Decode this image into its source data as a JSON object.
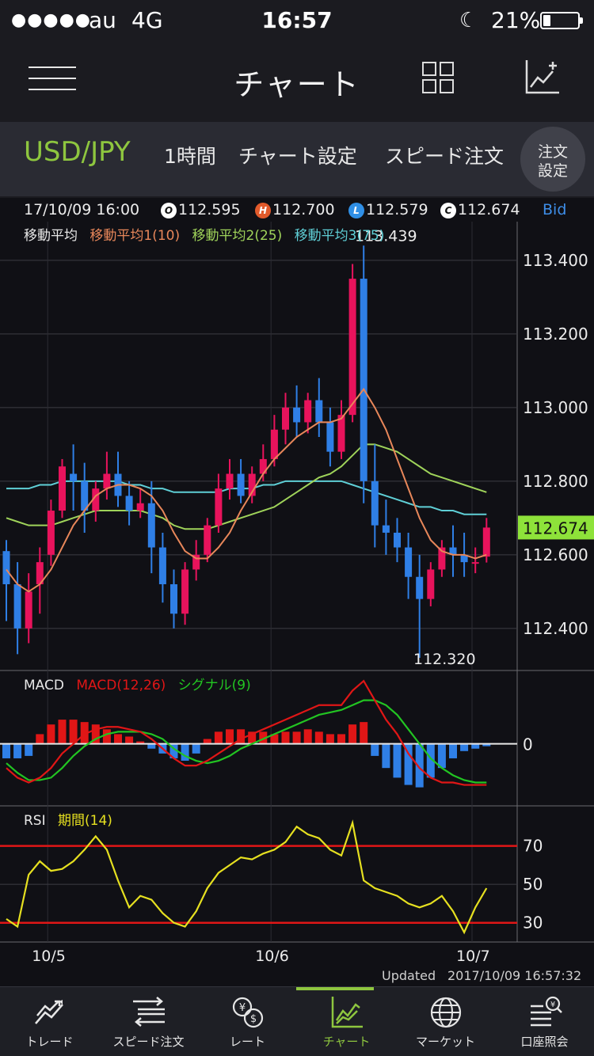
{
  "status_bar": {
    "signal_dots": "●●●●●",
    "carrier": "au",
    "network": "4G",
    "time": "16:57",
    "battery_percent": "21%",
    "icons": [
      "signal-dots-icon",
      "moon-icon",
      "battery-icon"
    ]
  },
  "nav": {
    "title": "チャート",
    "icons": [
      "menu-icon",
      "layout-grid-icon",
      "chart-add-icon"
    ]
  },
  "toolbar": {
    "pair": "USD/JPY",
    "timeframe": "1時間",
    "chart_settings": "チャート設定",
    "speed_order": "スピード注文",
    "order_settings_line1": "注文",
    "order_settings_line2": "設定"
  },
  "ohlc": {
    "datetime": "17/10/09 16:00",
    "open_badge": "O",
    "open": "112.595",
    "high_badge": "H",
    "high": "112.700",
    "low_badge": "L",
    "low": "112.579",
    "close_badge": "C",
    "close": "112.674",
    "price_type": "Bid"
  },
  "ma_legend": {
    "label": "移動平均",
    "ma1": "移動平均1(10)",
    "ma2": "移動平均2(25)",
    "ma3": "移動平均3(75)"
  },
  "macd_legend": {
    "label": "MACD",
    "macd": "MACD(12,26)",
    "signal": "シグナル(9)"
  },
  "rsi_legend": {
    "label": "RSI",
    "period": "期間(14)"
  },
  "updated": {
    "label": "Updated",
    "datetime": "2017/10/09 16:57:32"
  },
  "tabs": [
    {
      "label": "トレード",
      "icon": "trade-icon",
      "active": false
    },
    {
      "label": "スピード注文",
      "icon": "speed-order-icon",
      "active": false
    },
    {
      "label": "レート",
      "icon": "rate-icon",
      "active": false
    },
    {
      "label": "チャート",
      "icon": "chart-icon",
      "active": true
    },
    {
      "label": "マーケット",
      "icon": "globe-icon",
      "active": false
    },
    {
      "label": "口座照会",
      "icon": "account-search-icon",
      "active": false
    }
  ],
  "colors": {
    "accent": "#8ec63f",
    "candle_up": "#e8135c",
    "candle_down": "#2f7fe6",
    "ma1": "#e8875a",
    "ma2": "#9fd35a",
    "ma3": "#5fcfd6",
    "macd": "#e01616",
    "signal": "#22c422",
    "rsi": "#e6e020",
    "rsi_bands": "#e01616",
    "current_price_bg": "#8ee23a"
  },
  "chart_data": [
    {
      "type": "candlestick",
      "title": "USD/JPY 1時間",
      "price_axis_labels": [
        "113.400",
        "113.200",
        "113.000",
        "112.800",
        "112.600",
        "112.400"
      ],
      "price_axis_values": [
        113.4,
        113.2,
        113.0,
        112.8,
        112.6,
        112.4
      ],
      "ylim": [
        112.29,
        113.505
      ],
      "x_labels": [
        "10/5",
        "10/6",
        "10/7"
      ],
      "x_label_index": [
        2,
        22,
        40
      ],
      "high_annotation": "113.439",
      "high_value": 113.439,
      "low_annotation": "112.320",
      "low_value": 112.32,
      "current_price_label": "112.674",
      "current_price": 112.674,
      "grid": true,
      "legend_position": "top-left",
      "candles": [
        {
          "o": 112.61,
          "h": 112.64,
          "c": 112.52,
          "l": 112.42
        },
        {
          "o": 112.52,
          "h": 112.58,
          "c": 112.4,
          "l": 112.33
        },
        {
          "o": 112.4,
          "h": 112.55,
          "c": 112.5,
          "l": 112.36
        },
        {
          "o": 112.52,
          "h": 112.62,
          "c": 112.58,
          "l": 112.44
        },
        {
          "o": 112.6,
          "h": 112.75,
          "c": 112.72,
          "l": 112.57
        },
        {
          "o": 112.72,
          "h": 112.86,
          "c": 112.84,
          "l": 112.7
        },
        {
          "o": 112.82,
          "h": 112.9,
          "c": 112.8,
          "l": 112.72
        },
        {
          "o": 112.8,
          "h": 112.85,
          "c": 112.72,
          "l": 112.66
        },
        {
          "o": 112.72,
          "h": 112.8,
          "c": 112.78,
          "l": 112.69
        },
        {
          "o": 112.78,
          "h": 112.88,
          "c": 112.82,
          "l": 112.75
        },
        {
          "o": 112.82,
          "h": 112.88,
          "c": 112.76,
          "l": 112.73
        },
        {
          "o": 112.76,
          "h": 112.8,
          "c": 112.72,
          "l": 112.68
        },
        {
          "o": 112.72,
          "h": 112.78,
          "c": 112.74,
          "l": 112.7
        },
        {
          "o": 112.74,
          "h": 112.8,
          "c": 112.62,
          "l": 112.55
        },
        {
          "o": 112.62,
          "h": 112.66,
          "c": 112.52,
          "l": 112.47
        },
        {
          "o": 112.52,
          "h": 112.56,
          "c": 112.44,
          "l": 112.4
        },
        {
          "o": 112.44,
          "h": 112.58,
          "c": 112.56,
          "l": 112.41
        },
        {
          "o": 112.56,
          "h": 112.64,
          "c": 112.6,
          "l": 112.53
        },
        {
          "o": 112.6,
          "h": 112.7,
          "c": 112.68,
          "l": 112.58
        },
        {
          "o": 112.68,
          "h": 112.82,
          "c": 112.78,
          "l": 112.66
        },
        {
          "o": 112.78,
          "h": 112.86,
          "c": 112.82,
          "l": 112.75
        },
        {
          "o": 112.82,
          "h": 112.86,
          "c": 112.76,
          "l": 112.74
        },
        {
          "o": 112.76,
          "h": 112.84,
          "c": 112.82,
          "l": 112.74
        },
        {
          "o": 112.82,
          "h": 112.9,
          "c": 112.86,
          "l": 112.8
        },
        {
          "o": 112.86,
          "h": 112.98,
          "c": 112.94,
          "l": 112.84
        },
        {
          "o": 112.94,
          "h": 113.04,
          "c": 113.0,
          "l": 112.9
        },
        {
          "o": 113.0,
          "h": 113.06,
          "c": 112.96,
          "l": 112.92
        },
        {
          "o": 112.96,
          "h": 113.04,
          "c": 113.02,
          "l": 112.93
        },
        {
          "o": 113.02,
          "h": 113.08,
          "c": 112.96,
          "l": 112.92
        },
        {
          "o": 112.96,
          "h": 113.0,
          "c": 112.88,
          "l": 112.84
        },
        {
          "o": 112.88,
          "h": 113.02,
          "c": 112.98,
          "l": 112.86
        },
        {
          "o": 112.98,
          "h": 113.39,
          "c": 113.35,
          "l": 112.96
        },
        {
          "o": 113.35,
          "h": 113.44,
          "c": 112.8,
          "l": 112.74
        },
        {
          "o": 112.8,
          "h": 112.9,
          "c": 112.68,
          "l": 112.62
        },
        {
          "o": 112.68,
          "h": 112.75,
          "c": 112.66,
          "l": 112.6
        },
        {
          "o": 112.66,
          "h": 112.7,
          "c": 112.62,
          "l": 112.58
        },
        {
          "o": 112.62,
          "h": 112.66,
          "c": 112.54,
          "l": 112.48
        },
        {
          "o": 112.54,
          "h": 112.6,
          "c": 112.48,
          "l": 112.32
        },
        {
          "o": 112.48,
          "h": 112.58,
          "c": 112.56,
          "l": 112.46
        },
        {
          "o": 112.56,
          "h": 112.64,
          "c": 112.62,
          "l": 112.54
        },
        {
          "o": 112.62,
          "h": 112.68,
          "c": 112.6,
          "l": 112.54
        },
        {
          "o": 112.6,
          "h": 112.66,
          "c": 112.58,
          "l": 112.54
        },
        {
          "o": 112.58,
          "h": 112.62,
          "c": 112.58,
          "l": 112.55
        },
        {
          "o": 112.595,
          "h": 112.7,
          "c": 112.674,
          "l": 112.579
        }
      ],
      "ma1_10": [
        112.56,
        112.52,
        112.5,
        112.52,
        112.56,
        112.62,
        112.68,
        112.72,
        112.76,
        112.78,
        112.79,
        112.79,
        112.78,
        112.76,
        112.72,
        112.66,
        112.61,
        112.59,
        112.59,
        112.62,
        112.66,
        112.72,
        112.77,
        112.82,
        112.86,
        112.89,
        112.92,
        112.94,
        112.96,
        112.96,
        112.97,
        113.01,
        113.05,
        113.0,
        112.94,
        112.86,
        112.78,
        112.7,
        112.64,
        112.61,
        112.6,
        112.6,
        112.59,
        112.6
      ],
      "ma2_25": [
        112.7,
        112.69,
        112.68,
        112.68,
        112.68,
        112.69,
        112.7,
        112.71,
        112.72,
        112.72,
        112.72,
        112.72,
        112.72,
        112.71,
        112.7,
        112.68,
        112.67,
        112.67,
        112.67,
        112.68,
        112.69,
        112.7,
        112.71,
        112.72,
        112.73,
        112.75,
        112.77,
        112.79,
        112.81,
        112.82,
        112.84,
        112.87,
        112.9,
        112.9,
        112.89,
        112.88,
        112.86,
        112.84,
        112.82,
        112.81,
        112.8,
        112.79,
        112.78,
        112.77
      ],
      "ma3_75": [
        112.78,
        112.78,
        112.78,
        112.79,
        112.79,
        112.8,
        112.8,
        112.8,
        112.8,
        112.8,
        112.8,
        112.79,
        112.79,
        112.78,
        112.78,
        112.77,
        112.77,
        112.77,
        112.77,
        112.77,
        112.78,
        112.78,
        112.78,
        112.79,
        112.79,
        112.8,
        112.8,
        112.8,
        112.8,
        112.8,
        112.8,
        112.79,
        112.78,
        112.77,
        112.76,
        112.75,
        112.74,
        112.73,
        112.73,
        112.72,
        112.72,
        112.71,
        112.71,
        112.71
      ]
    },
    {
      "type": "line",
      "title": "MACD",
      "zero_label": "0",
      "ylim": [
        -0.25,
        0.3
      ],
      "macd": [
        -0.1,
        -0.14,
        -0.16,
        -0.14,
        -0.1,
        -0.04,
        0.0,
        0.04,
        0.06,
        0.07,
        0.07,
        0.06,
        0.05,
        0.02,
        -0.02,
        -0.06,
        -0.09,
        -0.09,
        -0.07,
        -0.04,
        -0.01,
        0.02,
        0.04,
        0.06,
        0.08,
        0.1,
        0.12,
        0.14,
        0.16,
        0.16,
        0.16,
        0.22,
        0.26,
        0.18,
        0.1,
        0.04,
        -0.04,
        -0.1,
        -0.14,
        -0.16,
        -0.16,
        -0.17,
        -0.17,
        -0.17
      ],
      "signal": [
        -0.08,
        -0.12,
        -0.15,
        -0.15,
        -0.14,
        -0.1,
        -0.05,
        -0.01,
        0.02,
        0.04,
        0.05,
        0.05,
        0.05,
        0.04,
        0.02,
        -0.02,
        -0.05,
        -0.07,
        -0.08,
        -0.07,
        -0.05,
        -0.02,
        0.0,
        0.02,
        0.04,
        0.06,
        0.08,
        0.1,
        0.12,
        0.13,
        0.14,
        0.16,
        0.18,
        0.18,
        0.16,
        0.12,
        0.06,
        0.0,
        -0.06,
        -0.1,
        -0.13,
        -0.15,
        -0.16,
        -0.16
      ],
      "histogram": [
        -0.06,
        -0.06,
        -0.05,
        0.04,
        0.08,
        0.1,
        0.1,
        0.09,
        0.08,
        0.06,
        0.04,
        0.03,
        0.01,
        -0.02,
        -0.04,
        -0.06,
        -0.07,
        -0.04,
        0.02,
        0.05,
        0.06,
        0.06,
        0.05,
        0.05,
        0.04,
        0.05,
        0.05,
        0.06,
        0.05,
        0.04,
        0.04,
        0.08,
        0.09,
        -0.05,
        -0.1,
        -0.14,
        -0.17,
        -0.18,
        -0.14,
        -0.1,
        -0.06,
        -0.03,
        -0.02,
        -0.01
      ]
    },
    {
      "type": "line",
      "title": "RSI",
      "levels": [
        70,
        50,
        30
      ],
      "level_labels": [
        "70",
        "50",
        "30"
      ],
      "ylim": [
        20,
        90
      ],
      "rsi": [
        32,
        28,
        55,
        62,
        57,
        58,
        62,
        68,
        75,
        68,
        52,
        38,
        44,
        42,
        35,
        30,
        28,
        36,
        48,
        56,
        60,
        64,
        63,
        66,
        68,
        72,
        80,
        76,
        74,
        68,
        65,
        82,
        52,
        48,
        46,
        44,
        40,
        38,
        40,
        44,
        36,
        25,
        38,
        48
      ]
    }
  ]
}
